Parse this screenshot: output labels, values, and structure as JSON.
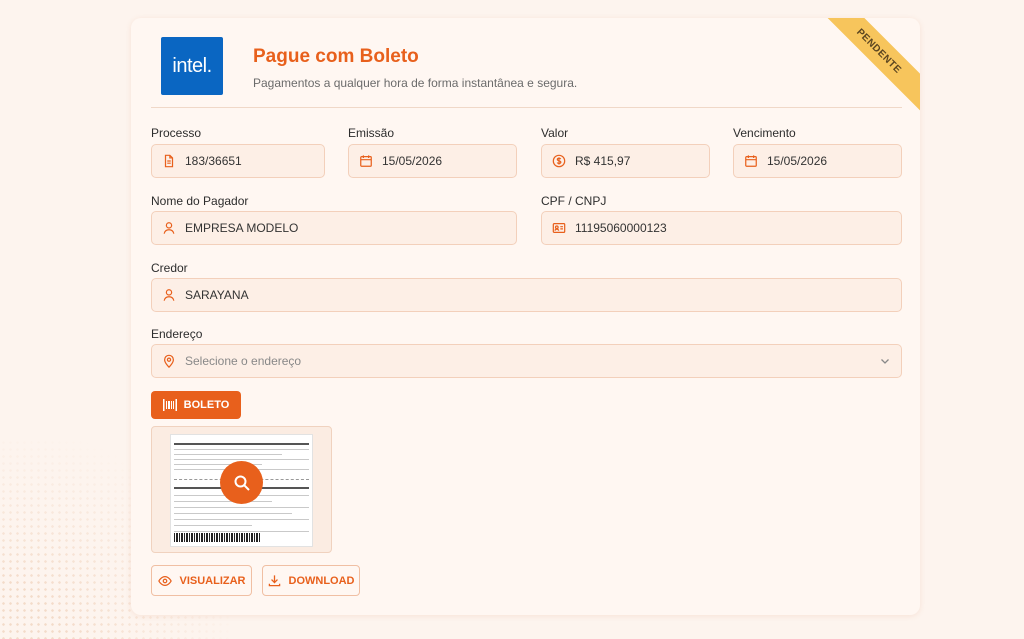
{
  "ribbon": "PENDENTE",
  "logo_text": "intel.",
  "header": {
    "title": "Pague com Boleto",
    "subtitle": "Pagamentos a qualquer hora de forma instantânea e segura."
  },
  "fields": {
    "processo": {
      "label": "Processo",
      "value": "183/36651",
      "icon": "document-icon"
    },
    "emissao": {
      "label": "Emissão",
      "value": "15/05/2026",
      "icon": "calendar-icon"
    },
    "valor": {
      "label": "Valor",
      "value": "R$ 415,97",
      "icon": "dollar-icon"
    },
    "vencimento": {
      "label": "Vencimento",
      "value": "15/05/2026",
      "icon": "calendar-icon"
    },
    "pagador": {
      "label": "Nome do Pagador",
      "value": "EMPRESA MODELO",
      "icon": "person-icon"
    },
    "cpf": {
      "label": "CPF / CNPJ",
      "value": "11195060000123",
      "icon": "id-card-icon"
    },
    "credor": {
      "label": "Credor",
      "value": "SARAYANA",
      "icon": "person-icon"
    },
    "endereco": {
      "label": "Endereço",
      "placeholder": "Selecione o endereço",
      "icon": "location-icon"
    }
  },
  "buttons": {
    "boleto": "BOLETO",
    "visualizar": "VISUALIZAR",
    "download": "DOWNLOAD"
  },
  "colors": {
    "accent": "#e8601c",
    "ribbon": "#f7c55c",
    "logo_bg": "#0a66c2"
  }
}
